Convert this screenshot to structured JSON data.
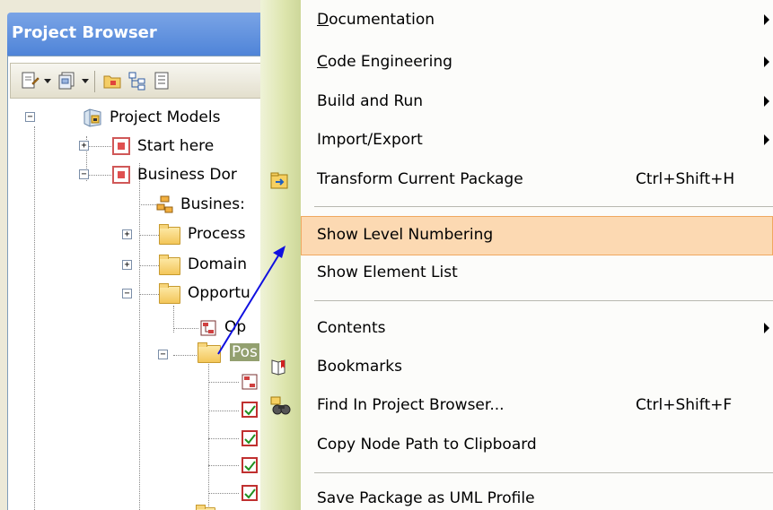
{
  "browser": {
    "title": "Project Browser",
    "tree": [
      {
        "label": "Project Models"
      },
      {
        "label": "Start here"
      },
      {
        "label": "Business Dor"
      },
      {
        "label": "Busines:"
      },
      {
        "label": "Process"
      },
      {
        "label": "Domain"
      },
      {
        "label": "Opportu"
      },
      {
        "label": "Op"
      },
      {
        "label": "Pos"
      }
    ]
  },
  "menu": {
    "items": [
      {
        "key": "D",
        "rest": "ocumentation",
        "submenu": true
      },
      {
        "key": "C",
        "rest": "ode Engineering",
        "submenu": true
      },
      {
        "label": "Build and Run",
        "submenu": true
      },
      {
        "label": "Import/Export",
        "submenu": true
      },
      {
        "label": "Transform Current Package",
        "shortcut": "Ctrl+Shift+H"
      },
      {
        "label": "Show Level Numbering",
        "highlighted": true
      },
      {
        "label": "Show Element List"
      },
      {
        "label": "Contents",
        "submenu": true
      },
      {
        "label": "Bookmarks"
      },
      {
        "label": "Find In Project Browser...",
        "shortcut": "Ctrl+Shift+F"
      },
      {
        "label": "Copy Node Path to Clipboard"
      },
      {
        "label": "Save Package as UML Profile"
      }
    ]
  },
  "colors": {
    "title_bar": "#4f84d8",
    "highlight": "#fcd9b2",
    "gutter": "#dde5ad",
    "annotation_arrow": "#1010e0"
  }
}
